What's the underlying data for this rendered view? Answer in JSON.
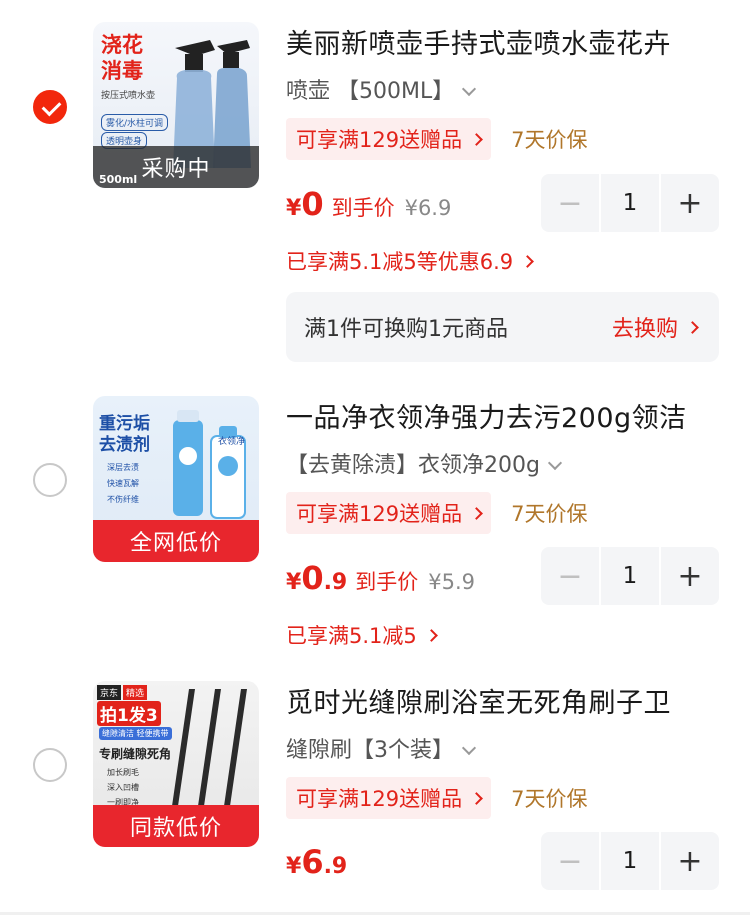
{
  "items": [
    {
      "selected": true,
      "thumb_title": "浇花消毒",
      "thumb_sub": "按压式喷水壶",
      "thumb_tag1": "雾化/水柱可调",
      "thumb_tag2": "透明壶身",
      "thumb_corner": "500ml",
      "thumb_banner": "采购中",
      "title": "美丽新喷壶手持式壶喷水壶花卉",
      "spec": "喷壶 【500ML】",
      "promo": "可享满129送赠品",
      "protect": "7天价保",
      "price_symbol": "¥",
      "price_int": "0",
      "price_dec": "",
      "price_label": "到手价",
      "orig_price": "¥6.9",
      "qty": "1",
      "minus": "−",
      "plus": "+",
      "saving": "已享满5.1减5等优惠6.9",
      "swap_text": "满1件可换购1元商品",
      "swap_link": "去换购"
    },
    {
      "selected": false,
      "thumb_title": "重污垢去渍剂",
      "thumb_tag1": "深层去渍",
      "thumb_tag2": "快速瓦解",
      "thumb_tag3": "不伤纤维",
      "thumb_product": "衣领净",
      "thumb_banner": "全网低价",
      "title": "一品净衣领净强力去污200g领洁",
      "spec": "【去黄除渍】衣领净200g",
      "promo": "可享满129送赠品",
      "protect": "7天价保",
      "price_symbol": "¥",
      "price_int": "0",
      "price_dec": ".9",
      "price_label": "到手价",
      "orig_price": "¥5.9",
      "qty": "1",
      "minus": "−",
      "plus": "+",
      "saving": "已享满5.1减5"
    },
    {
      "selected": false,
      "thumb_badge1": "京东",
      "thumb_badge2": "精选",
      "thumb_title": "拍1发3",
      "thumb_sub": "缝隙清洁 轻便携带",
      "thumb_heading": "专刷缝隙死角",
      "thumb_tag1": "加长刷毛",
      "thumb_tag2": "深入凹槽",
      "thumb_tag3": "一刷即净",
      "thumb_banner": "同款低价",
      "title": "觅时光缝隙刷浴室无死角刷子卫",
      "spec": "缝隙刷【3个装】",
      "promo": "可享满129送赠品",
      "protect": "7天价保",
      "price_symbol": "¥",
      "price_int": "6",
      "price_dec": ".9",
      "qty": "1",
      "minus": "−",
      "plus": "+"
    }
  ],
  "colors": {
    "accent": "#e2231a",
    "protect": "#b0762a",
    "promo_bg": "#fdeeee"
  },
  "icons": {
    "check": "check-circle-icon",
    "chevron": "chevron-down-icon",
    "arrow": "chevron-right-icon"
  }
}
